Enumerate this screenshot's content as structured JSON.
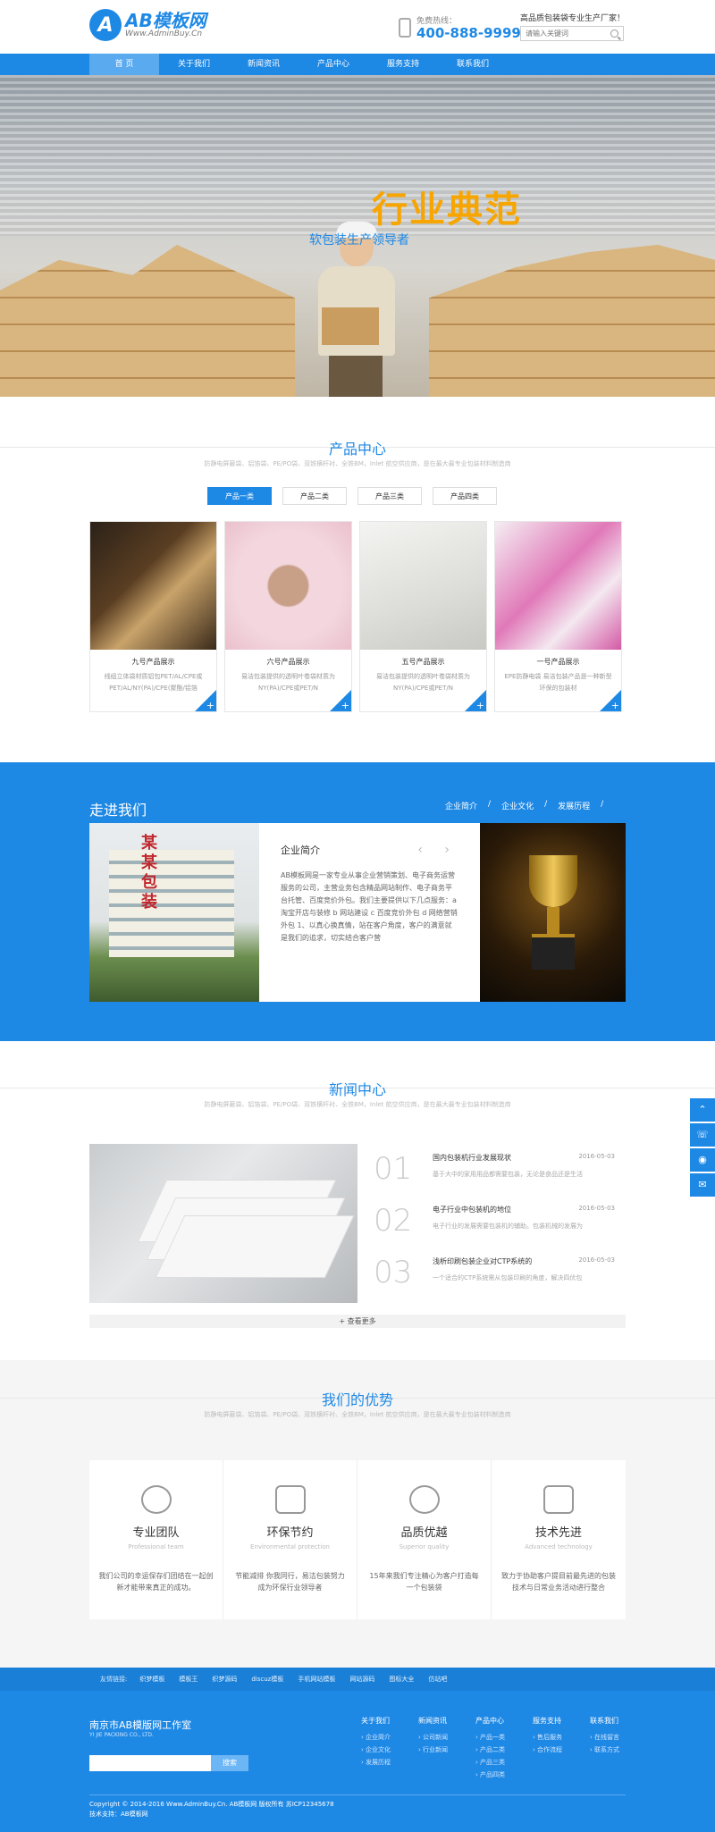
{
  "header": {
    "logo_mark": "A",
    "logo_name": "AB模板网",
    "logo_url": "Www.AdminBuy.Cn",
    "hotline_label": "免费热线：",
    "hotline_number": "400-888-9999",
    "slogan": "高品质包装袋专业生产厂家！",
    "search_placeholder": "请输入关键词"
  },
  "nav": {
    "items": [
      "首 页",
      "关于我们",
      "新闻资讯",
      "产品中心",
      "服务支持",
      "联系我们"
    ],
    "active_index": 0
  },
  "banner": {
    "title": "行业典范",
    "subtitle": "软包装生产领导者"
  },
  "products": {
    "title": "产品中心",
    "desc": "防静电屏蔽袋、铝箔袋、PE/PO袋、双铁横杆衬、全铁BM，Inlet 航空供应商，是在最大最专业包装材料制造商",
    "tabs": [
      "产品一类",
      "产品二类",
      "产品三类",
      "产品四类"
    ],
    "active_tab": 0,
    "items": [
      {
        "name": "九号产品展示",
        "desc": "线组立体袋材质铝包PET/AL/CPE或PET/AL/NY(PA)/CPE(聚酯/铝箔"
      },
      {
        "name": "六号产品展示",
        "desc": "易洁包装提供的透明叶卷袋材质为NY(PA)/CPE或PET/N"
      },
      {
        "name": "五号产品展示",
        "desc": "易洁包装提供的透明叶卷袋材质为NY(PA)/CPE或PET/N"
      },
      {
        "name": "一号产品展示",
        "desc": "EPE防静电袋 易洁包装产品是一种新型环保的包装材"
      }
    ]
  },
  "about": {
    "title": "走进我们",
    "links": [
      "企业简介",
      "企业文化",
      "发展历程"
    ],
    "sign": "某某包装",
    "text_title": "企业简介",
    "arrows": "‹ ›",
    "text": "AB模板网是一家专业从事企业营销策划、电子商务运营服务的公司，主营业务包含精品网站制作、电子商务平台托管、百度竞价外包。我们主要提供以下几点服务：a 淘宝开店与装修 b 网站建设 c 百度竞价外包 d 网络营销外包 1、以真心换真情，站在客户角度，客户的满意就是我们的追求，切实结合客户营"
  },
  "news": {
    "title": "新闻中心",
    "desc": "防静电屏蔽袋、铝箔袋、PE/PO袋、双铁横杆衬、全铁BM，Inlet 航空供应商，是在最大最专业包装材料制造商",
    "items": [
      {
        "num": "01",
        "title": "国内包装机行业发展现状",
        "date": "2016-05-03",
        "summary": "基于大中的家用用品都需要包装，无论是食品还是生活"
      },
      {
        "num": "02",
        "title": "电子行业中包装机的地位",
        "date": "2016-05-03",
        "summary": "电子行业的发展需要包装机的辅助。包装机械的发展为"
      },
      {
        "num": "03",
        "title": "浅析印刷包装企业对CTP系统的",
        "date": "2016-05-03",
        "summary": "一个适合的CTP系统需从包装印刷的角度，解决四优包"
      }
    ],
    "more": "+ 查看更多"
  },
  "advantages": {
    "title": "我们的优势",
    "desc": "防静电屏蔽袋、铝箔袋、PE/PO袋、双铁横杆衬、全铁BM，Inlet 航空供应商，是在最大最专业包装材料制造商",
    "items": [
      {
        "name": "专业团队",
        "en": "Professional team",
        "desc": "我们公司的幸运保存们团结在一起创新才能带来真正的成功。"
      },
      {
        "name": "环保节约",
        "en": "Environmental protection",
        "desc": "节能减排 你我同行，易洁包装努力成为环保行业领导者"
      },
      {
        "name": "品质优越",
        "en": "Superior quality",
        "desc": "15年来我们专注精心为客户打造每一个包装袋"
      },
      {
        "name": "技术先进",
        "en": "Advanced technology",
        "desc": "致力于协助客户提目前最先进的包装技术与日常业务活动进行整合"
      }
    ]
  },
  "friend_links": {
    "label": "友情链接:",
    "items": [
      "织梦模板",
      "模板王",
      "织梦源码",
      "discuz模板",
      "手机网站模板",
      "网站源码",
      "图标大全",
      "仿站吧"
    ]
  },
  "footer": {
    "company": "南京市AB模版网工作室",
    "company_en": "YI JIE PACKING CO., LTD.",
    "search_button": "搜索",
    "columns": [
      {
        "title": "关于我们",
        "items": [
          "企业简介",
          "企业文化",
          "发展历程"
        ]
      },
      {
        "title": "新闻资讯",
        "items": [
          "公司新闻",
          "行业新闻"
        ]
      },
      {
        "title": "产品中心",
        "items": [
          "产品一类",
          "产品二类",
          "产品三类",
          "产品四类"
        ]
      },
      {
        "title": "服务支持",
        "items": [
          "售后服务",
          "合作流程"
        ]
      },
      {
        "title": "联系我们",
        "items": [
          "在线留言",
          "联系方式"
        ]
      }
    ],
    "copyright": "Copyright © 2014-2016 Www.AdminBuy.Cn. AB模板网 版权所有 苏ICP12345678",
    "tech_support": "技术支持：AB模板网"
  },
  "side_tools": [
    "⌃",
    "☏",
    "◉",
    "✉"
  ],
  "colors": {
    "brand_blue": "#1e88e5",
    "banner_orange": "#f7a500"
  }
}
